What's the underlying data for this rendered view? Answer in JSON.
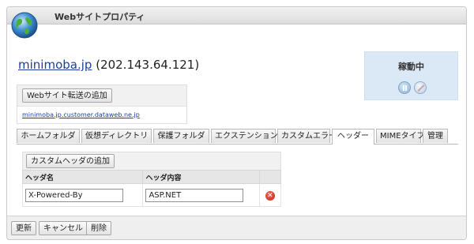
{
  "window": {
    "title": "Webサイトプロパティ",
    "icon": "globe-icon"
  },
  "site": {
    "domain": "minimoba.jp",
    "ip": "(202.143.64.121)"
  },
  "forwarding": {
    "add_button": "Webサイト転送の追加",
    "url": "minimoba.jp.customer.dataweb.ne.jp"
  },
  "status": {
    "label": "稼動中",
    "icons": [
      "pause-icon",
      "stop-icon"
    ],
    "bg_color": "#dbe8f6"
  },
  "tabs": [
    {
      "label": "ホームフォルダ"
    },
    {
      "label": "仮想ディレクトリ"
    },
    {
      "label": "保護フォルダ"
    },
    {
      "label": "エクステンション"
    },
    {
      "label": "カスタムエラー"
    },
    {
      "label": "ヘッダー",
      "active": true
    },
    {
      "label": "MIMEタイプ"
    },
    {
      "label": "管理"
    }
  ],
  "headers": {
    "add_button": "カスタムヘッダの追加",
    "columns": [
      "ヘッダ名",
      "ヘッダ内容"
    ],
    "rows": [
      {
        "name": "X-Powered-By",
        "value": "ASP.NET"
      }
    ]
  },
  "footer": {
    "update": "更新",
    "cancel": "キャンセル",
    "delete": "削除"
  },
  "colors": {
    "link": "#1a3f9e",
    "delete": "#c0241a"
  }
}
